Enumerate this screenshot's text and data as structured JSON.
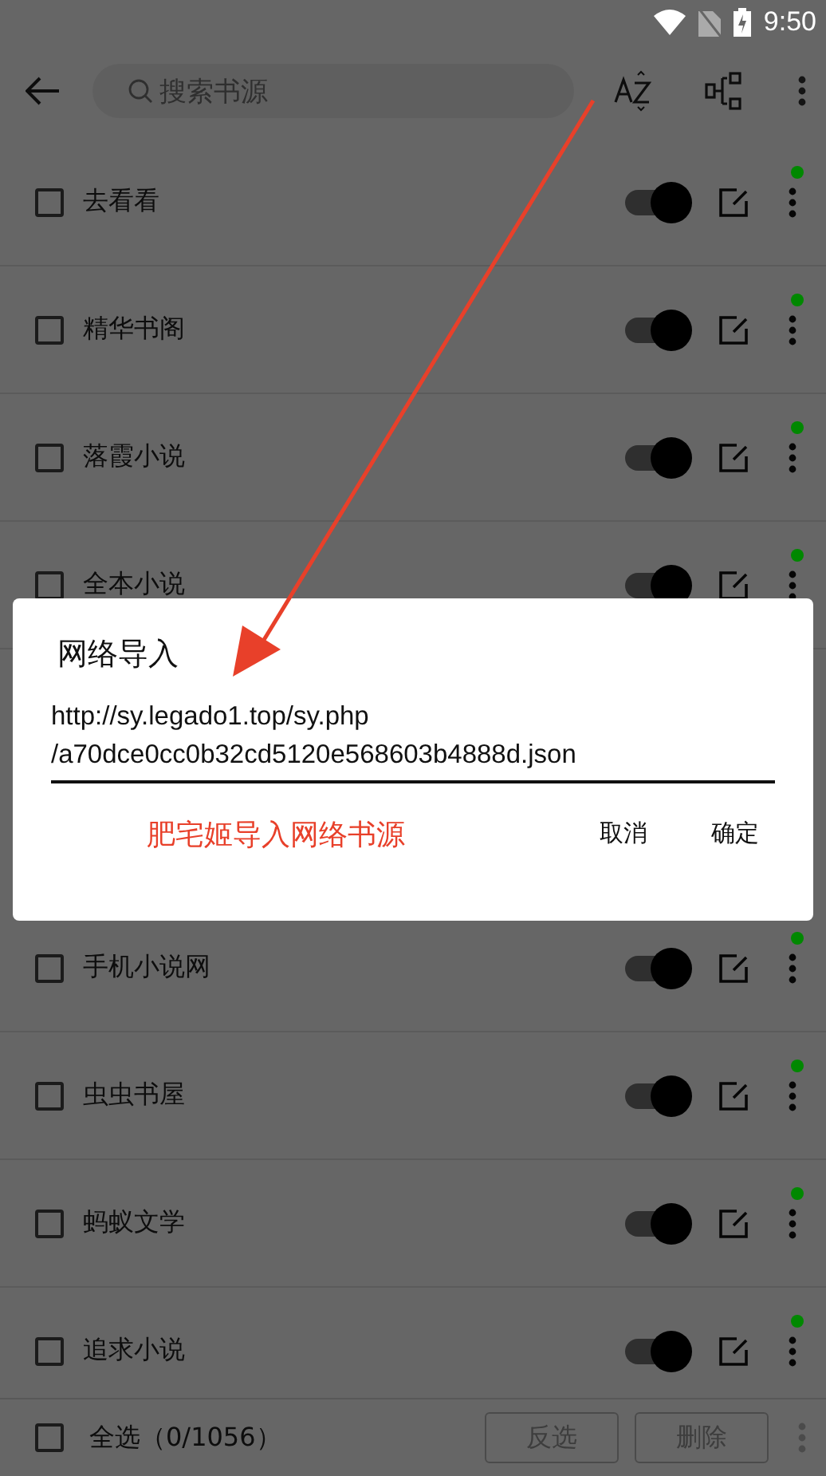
{
  "status_bar": {
    "time": "9:50"
  },
  "toolbar": {
    "search": {
      "placeholder": "搜索书源"
    }
  },
  "sources": [
    {
      "name": "去看看",
      "checked": false,
      "enabled": true,
      "color": "#008800"
    },
    {
      "name": "精华书阁",
      "checked": false,
      "enabled": true,
      "color": "#008800"
    },
    {
      "name": "落霞小说",
      "checked": false,
      "enabled": true,
      "color": "#008800"
    },
    {
      "name": "全本小说",
      "checked": false,
      "enabled": true,
      "color": "#008800"
    },
    {
      "name": "手机小说网",
      "checked": false,
      "enabled": true,
      "color": "#008800"
    },
    {
      "name": "虫虫书屋",
      "checked": false,
      "enabled": true,
      "color": "#008800"
    },
    {
      "name": "蚂蚁文学",
      "checked": false,
      "enabled": true,
      "color": "#008800"
    },
    {
      "name": "追求小说",
      "checked": false,
      "enabled": true,
      "color": "#008800"
    }
  ],
  "bottom_bar": {
    "select_all": {
      "label": "全选（0/1056）",
      "checked": false
    },
    "buttons": [
      {
        "label": "反选",
        "disabled": true
      },
      {
        "label": "删除",
        "disabled": true
      }
    ]
  },
  "dialog": {
    "title": "网络导入",
    "url_field": {
      "value": "http://sy.legado1.top/sy.php\n/a70dce0cc0b32cd5120e568603b4888d.json"
    },
    "annotation": "肥宅姬导入网络书源",
    "buttons": [
      "取消",
      "确定"
    ]
  }
}
